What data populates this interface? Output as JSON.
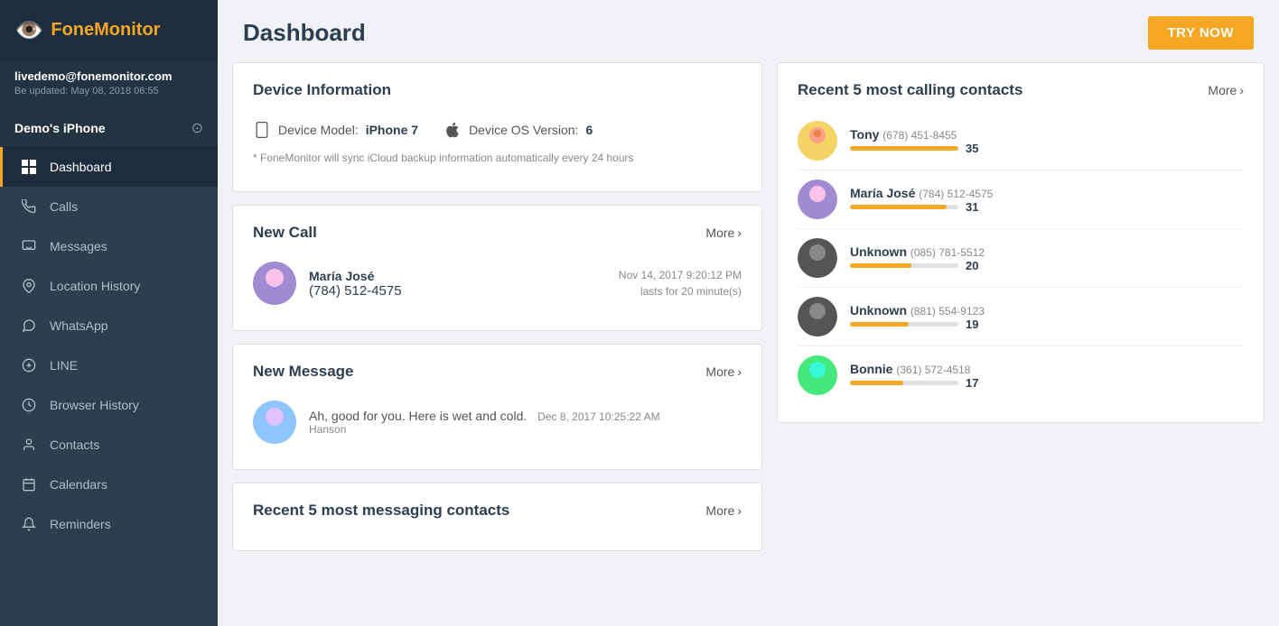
{
  "app": {
    "logo_icon": "👁️",
    "logo_text": "FoneMonitor",
    "try_now_label": "TRY NOW"
  },
  "sidebar": {
    "user": {
      "email": "livedemo@fonemonitor.com",
      "updated": "Be updated: May 08, 2018 06:55"
    },
    "device": {
      "name": "Demo's iPhone"
    },
    "nav_items": [
      {
        "id": "dashboard",
        "label": "Dashboard",
        "icon": "grid",
        "active": true
      },
      {
        "id": "calls",
        "label": "Calls",
        "icon": "phone"
      },
      {
        "id": "messages",
        "label": "Messages",
        "icon": "message"
      },
      {
        "id": "location",
        "label": "Location History",
        "icon": "pin"
      },
      {
        "id": "whatsapp",
        "label": "WhatsApp",
        "icon": "chat"
      },
      {
        "id": "line",
        "label": "LINE",
        "icon": "line"
      },
      {
        "id": "browser",
        "label": "Browser History",
        "icon": "clock"
      },
      {
        "id": "contacts",
        "label": "Contacts",
        "icon": "person"
      },
      {
        "id": "calendars",
        "label": "Calendars",
        "icon": "calendar"
      },
      {
        "id": "reminders",
        "label": "Reminders",
        "icon": "bell"
      }
    ]
  },
  "main": {
    "title": "Dashboard",
    "device_info": {
      "card_title": "Device Information",
      "model_label": "Device Model:",
      "model_value": "iPhone 7",
      "os_label": "Device OS Version:",
      "os_value": "6",
      "note": "* FoneMonitor will sync iCloud backup information automatically every 24 hours"
    },
    "new_call": {
      "card_title": "New Call",
      "more_label": "More",
      "caller_name": "María José",
      "caller_phone": "(784) 512-4575",
      "call_time": "Nov 14, 2017 9:20:12 PM",
      "call_duration": "lasts for 20 minute(s)"
    },
    "new_message": {
      "card_title": "New Message",
      "more_label": "More",
      "message_text": "Ah, good for you. Here is wet and cold.",
      "message_time": "Dec 8, 2017 10:25:22 AM",
      "sender": "Hanson"
    },
    "messaging_contacts": {
      "card_title": "Recent 5 most messaging contacts",
      "more_label": "More"
    },
    "calling_contacts": {
      "card_title": "Recent 5 most calling contacts",
      "more_label": "More",
      "contacts": [
        {
          "name": "Tony",
          "phone": "(678) 451-8455",
          "count": 35,
          "bar_pct": 100,
          "avatar": "tony"
        },
        {
          "name": "María José",
          "phone": "(784) 512-4575",
          "count": 31,
          "bar_pct": 89,
          "avatar": "maria"
        },
        {
          "name": "Unknown",
          "phone": "(085) 781-5512",
          "count": 20,
          "bar_pct": 57,
          "avatar": "unknown"
        },
        {
          "name": "Unknown",
          "phone": "(881) 554-9123",
          "count": 19,
          "bar_pct": 54,
          "avatar": "unknown"
        },
        {
          "name": "Bonnie",
          "phone": "(361) 572-4518",
          "count": 17,
          "bar_pct": 49,
          "avatar": "bonnie"
        }
      ]
    }
  }
}
